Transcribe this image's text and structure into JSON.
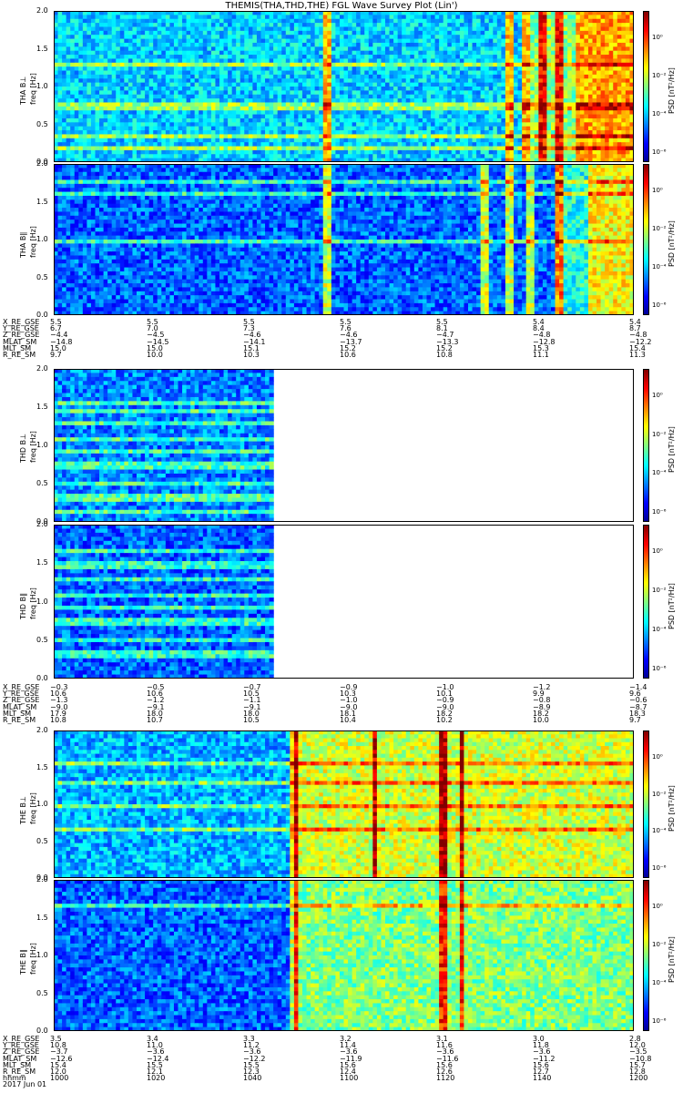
{
  "title": "THEMIS(THA,THD,THE) FGL Wave Survey Plot (Lin')",
  "colorbar_label": "PSD [nT²/Hz]",
  "colorbar_ticks": [
    "10⁰",
    "10⁻²",
    "10⁻⁴",
    "10⁻⁶"
  ],
  "panels": [
    {
      "probe": "tha",
      "ylabel1": "THA B⊥",
      "ylabel2": "freq [Hz]",
      "yticks": [
        "0.0",
        "0.5",
        "1.0",
        "1.5",
        "2.0"
      ]
    },
    {
      "probe": "tha",
      "ylabel1": "THA B∥",
      "ylabel2": "freq [Hz]",
      "yticks": [
        "0.0",
        "0.5",
        "1.0",
        "1.5",
        "2.0"
      ]
    },
    {
      "probe": "thd",
      "ylabel1": "THD B⊥",
      "ylabel2": "freq [Hz]",
      "yticks": [
        "0.0",
        "0.5",
        "1.0",
        "1.5",
        "2.0"
      ]
    },
    {
      "probe": "thd",
      "ylabel1": "THD B∥",
      "ylabel2": "freq [Hz]",
      "yticks": [
        "0.0",
        "0.5",
        "1.0",
        "1.5",
        "2.0"
      ]
    },
    {
      "probe": "the",
      "ylabel1": "THE B⊥",
      "ylabel2": "freq [Hz]",
      "yticks": [
        "0.0",
        "0.5",
        "1.0",
        "1.5",
        "2.0"
      ]
    },
    {
      "probe": "the",
      "ylabel1": "THE B∥",
      "ylabel2": "freq [Hz]",
      "yticks": [
        "0.0",
        "0.5",
        "1.0",
        "1.5",
        "2.0"
      ]
    }
  ],
  "ephemeris": [
    {
      "rows": [
        {
          "label": "X_RE_GSE",
          "values": [
            "5.5",
            "5.5",
            "5.5",
            "5.5",
            "5.5",
            "5.4",
            "5.4"
          ]
        },
        {
          "label": "Y_RE_GSE",
          "values": [
            "6.7",
            "7.0",
            "7.3",
            "7.6",
            "8.1",
            "8.4",
            "8.7"
          ]
        },
        {
          "label": "Z_RE_GSE",
          "values": [
            "−4.4",
            "−4.5",
            "−4.6",
            "−4.6",
            "−4.7",
            "−4.8",
            "−4.8"
          ]
        },
        {
          "label": "MLAT_SM",
          "values": [
            "−14.8",
            "−14.5",
            "−14.1",
            "−13.7",
            "−13.3",
            "−12.8",
            "−12.2"
          ]
        },
        {
          "label": "MLT_SM",
          "values": [
            "15.0",
            "15.0",
            "15.1",
            "15.2",
            "15.2",
            "15.3",
            "15.4"
          ]
        },
        {
          "label": "R_RE_SM",
          "values": [
            "9.7",
            "10.0",
            "10.3",
            "10.6",
            "10.8",
            "11.1",
            "11.3"
          ]
        }
      ]
    },
    {
      "rows": [
        {
          "label": "X_RE_GSE",
          "values": [
            "−0.3",
            "−0.5",
            "−0.7",
            "−0.9",
            "−1.0",
            "−1.2",
            "−1.4"
          ]
        },
        {
          "label": "Y_RE_GSE",
          "values": [
            "10.6",
            "10.6",
            "10.5",
            "10.3",
            "10.1",
            "9.9",
            "9.6"
          ]
        },
        {
          "label": "Z_RE_GSE",
          "values": [
            "−1.3",
            "−1.2",
            "−1.1",
            "−1.0",
            "−0.9",
            "−0.8",
            "−0.6"
          ]
        },
        {
          "label": "MLAT_SM",
          "values": [
            "−9.0",
            "−9.1",
            "−9.1",
            "−9.0",
            "−9.0",
            "−8.9",
            "−8.7"
          ]
        },
        {
          "label": "MLT_SM",
          "values": [
            "17.9",
            "18.0",
            "18.0",
            "18.1",
            "18.2",
            "18.2",
            "18.3"
          ]
        },
        {
          "label": "R_RE_SM",
          "values": [
            "10.8",
            "10.7",
            "10.5",
            "10.4",
            "10.2",
            "10.0",
            "9.7"
          ]
        }
      ]
    },
    {
      "rows": [
        {
          "label": "X_RE_GSE",
          "values": [
            "3.5",
            "3.4",
            "3.3",
            "3.2",
            "3.1",
            "3.0",
            "2.8"
          ]
        },
        {
          "label": "Y_RE_GSE",
          "values": [
            "10.8",
            "11.0",
            "11.2",
            "11.4",
            "11.6",
            "11.8",
            "12.0"
          ]
        },
        {
          "label": "Z_RE_GSE",
          "values": [
            "−3.7",
            "−3.6",
            "−3.6",
            "−3.6",
            "−3.6",
            "−3.6",
            "−3.5"
          ]
        },
        {
          "label": "MLAT_SM",
          "values": [
            "−12.6",
            "−12.4",
            "−12.2",
            "−11.9",
            "−11.6",
            "−11.2",
            "−10.8"
          ]
        },
        {
          "label": "MLT_SM",
          "values": [
            "15.4",
            "15.5",
            "15.5",
            "15.6",
            "15.6",
            "15.6",
            "15.7"
          ]
        },
        {
          "label": "R_RE_SM",
          "values": [
            "12.0",
            "12.1",
            "12.3",
            "12.4",
            "12.6",
            "12.7",
            "12.8"
          ]
        },
        {
          "label": "hhmm",
          "values": [
            "1000",
            "1020",
            "1040",
            "1100",
            "1120",
            "1140",
            "1200"
          ]
        },
        {
          "label": "2017 Jun 01",
          "values": [
            "",
            "",
            "",
            "",
            "",
            "",
            ""
          ]
        }
      ]
    }
  ],
  "colors": {
    "jet": [
      "#00008f",
      "#0000ff",
      "#0080ff",
      "#00ffff",
      "#80ff80",
      "#ffff00",
      "#ff8000",
      "#ff0000",
      "#800000"
    ],
    "axis": "#000000",
    "background": "#ffffff"
  },
  "chart_data": {
    "type": "heatmap",
    "title": "THEMIS(THA,THD,THE) FGL Wave Survey Plot (Lin')",
    "x": [
      "1000",
      "1020",
      "1040",
      "1100",
      "1120",
      "1140",
      "1200"
    ],
    "xlabel": "hhmm",
    "date": "2017 Jun 01",
    "ylabel": "freq [Hz]",
    "ylim": [
      0,
      2
    ],
    "colorbar": {
      "label": "PSD [nT²/Hz]",
      "scale": "log",
      "ticks": [
        "10⁰",
        "10⁻²",
        "10⁻⁴",
        "10⁻⁶"
      ]
    },
    "series": [
      {
        "name": "THA B⊥"
      },
      {
        "name": "THA B∥"
      },
      {
        "name": "THD B⊥"
      },
      {
        "name": "THD B∥"
      },
      {
        "name": "THE B⊥"
      },
      {
        "name": "THE B∥"
      }
    ]
  }
}
